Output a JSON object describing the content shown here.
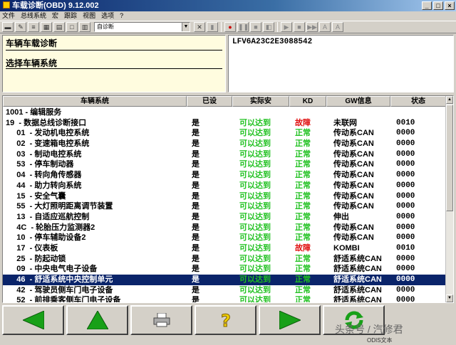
{
  "window": {
    "title": "车载诊断(OBD) 9.12.002",
    "min": "_",
    "max": "□",
    "close": "×"
  },
  "menu": [
    "文件",
    "总线系统",
    "宏",
    "跟踪",
    "视图",
    "选项",
    "?"
  ],
  "toolbar": {
    "combo_value": "自诊断",
    "combo_arrow": "▼"
  },
  "left_panel": {
    "line1": "车辆车载诊断",
    "line2": "选择车辆系统"
  },
  "right_panel": {
    "vin": "LFV6A23C2E3088542"
  },
  "columns": [
    "车辆系统",
    "已设",
    "实际安",
    "KD",
    "GW信息",
    "状态"
  ],
  "rows": [
    {
      "name": "1001 - 编辑服务",
      "set": "",
      "actual": "",
      "kd": "",
      "gw": "",
      "status": ""
    },
    {
      "name": "19  - 数据总线诊断接口",
      "set": "是",
      "actual": "可以达到",
      "kd": "故障",
      "gw": "未联网",
      "status": "0010"
    },
    {
      "name": "     01  - 发动机电控系统",
      "set": "是",
      "actual": "可以达到",
      "kd": "正常",
      "gw": "传动系CAN",
      "status": "0000"
    },
    {
      "name": "     02  - 变速箱电控系统",
      "set": "是",
      "actual": "可以达到",
      "kd": "正常",
      "gw": "传动系CAN",
      "status": "0000"
    },
    {
      "name": "     03  - 制动电控系统",
      "set": "是",
      "actual": "可以达到",
      "kd": "正常",
      "gw": "传动系CAN",
      "status": "0000"
    },
    {
      "name": "     53  - 停车制动器",
      "set": "是",
      "actual": "可以达到",
      "kd": "正常",
      "gw": "传动系CAN",
      "status": "0000"
    },
    {
      "name": "     04  - 转向角传感器",
      "set": "是",
      "actual": "可以达到",
      "kd": "正常",
      "gw": "传动系CAN",
      "status": "0000"
    },
    {
      "name": "     44  - 助力转向系统",
      "set": "是",
      "actual": "可以达到",
      "kd": "正常",
      "gw": "传动系CAN",
      "status": "0000"
    },
    {
      "name": "     15  - 安全气囊",
      "set": "是",
      "actual": "可以达到",
      "kd": "正常",
      "gw": "传动系CAN",
      "status": "0000"
    },
    {
      "name": "     55  - 大灯照明距离调节装置",
      "set": "是",
      "actual": "可以达到",
      "kd": "正常",
      "gw": "传动系CAN",
      "status": "0000"
    },
    {
      "name": "     13  - 自适应巡航控制",
      "set": "是",
      "actual": "可以达到",
      "kd": "正常",
      "gw": "伸出",
      "status": "0000"
    },
    {
      "name": "     4C  - 轮胎压力监测器2",
      "set": "是",
      "actual": "可以达到",
      "kd": "正常",
      "gw": "传动系CAN",
      "status": "0000"
    },
    {
      "name": "     10  - 停车辅助设备2",
      "set": "是",
      "actual": "可以达到",
      "kd": "正常",
      "gw": "传动系CAN",
      "status": "0000"
    },
    {
      "name": "     17  - 仪表板",
      "set": "是",
      "actual": "可以达到",
      "kd": "故障",
      "gw": "KOMBI",
      "status": "0010"
    },
    {
      "name": "     25  - 防起动锁",
      "set": "是",
      "actual": "可以达到",
      "kd": "正常",
      "gw": "舒适系统CAN",
      "status": "0000"
    },
    {
      "name": "     09  - 中央电气电子设备",
      "set": "是",
      "actual": "可以达到",
      "kd": "正常",
      "gw": "舒适系统CAN",
      "status": "0000"
    },
    {
      "name": "     46  - 舒适系统中央控制单元",
      "set": "是",
      "actual": "可以达到",
      "kd": "正常",
      "gw": "舒适系统CAN",
      "status": "0000"
    },
    {
      "name": "     42  - 驾驶员侧车门电子设备",
      "set": "是",
      "actual": "可以达到",
      "kd": "正常",
      "gw": "舒适系统CAN",
      "status": "0000"
    },
    {
      "name": "     52  - 前排乘客侧车门电子设备",
      "set": "是",
      "actual": "可以达到",
      "kd": "正常",
      "gw": "舒适系统CAN",
      "status": "0000"
    }
  ],
  "selected_row": 16,
  "status_bar": {
    "text": "ODIS文本",
    "watermark": "头条号 / 汽修君"
  },
  "colors": {
    "ok": "#1fc11f",
    "fault": "#e01010",
    "selection": "#0a246a",
    "panel_yellow": "#fffcdf"
  }
}
